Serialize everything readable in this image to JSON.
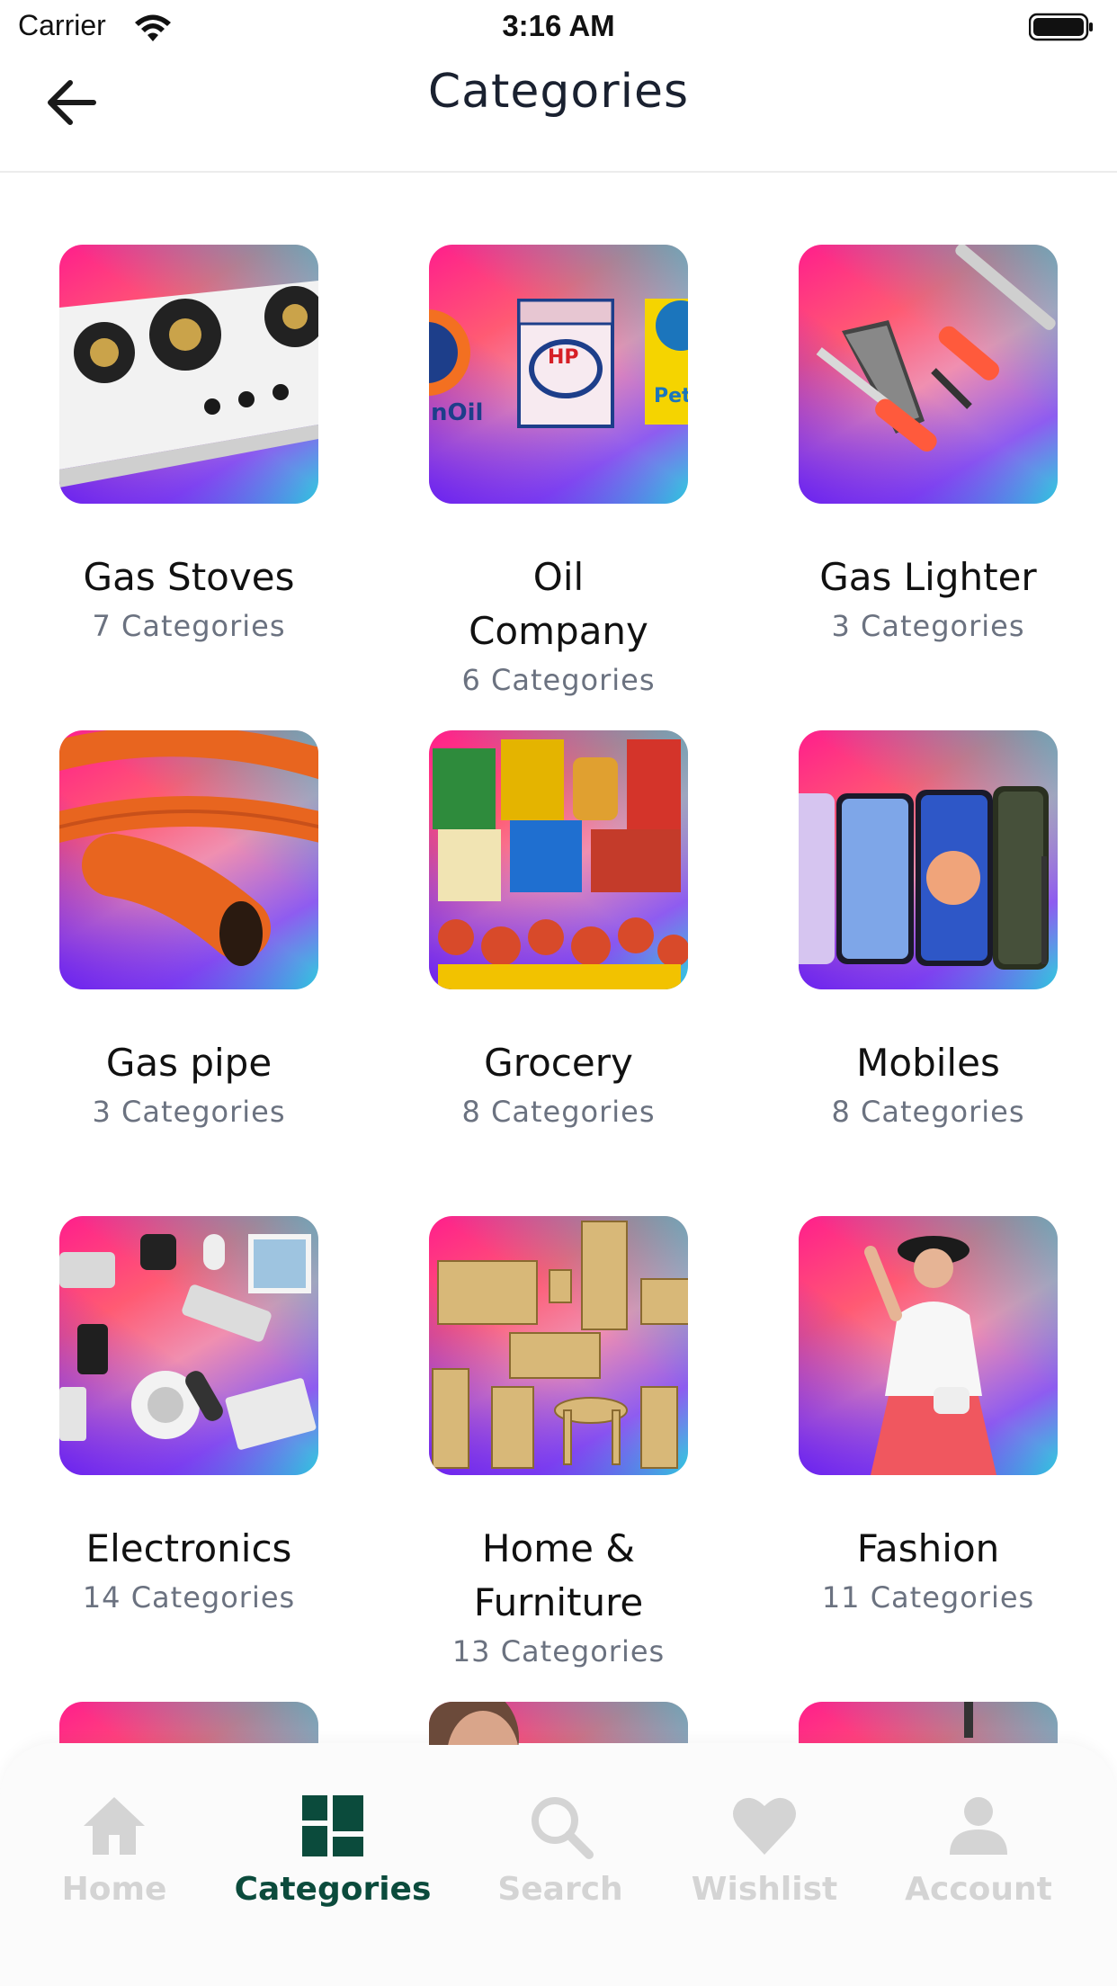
{
  "status_bar": {
    "carrier": "Carrier",
    "time": "3:16 AM"
  },
  "header": {
    "title": "Categories"
  },
  "categories": [
    {
      "name": "Gas Stoves",
      "count": "7 Categories",
      "image": "gas-stove"
    },
    {
      "name": "Oil Company",
      "count": "6 Categories",
      "image": "oil-company"
    },
    {
      "name": "Gas Lighter",
      "count": "3 Categories",
      "image": "gas-lighter"
    },
    {
      "name": "Gas pipe",
      "count": "3 Categories",
      "image": "gas-pipe"
    },
    {
      "name": "Grocery",
      "count": "8 Categories",
      "image": "grocery"
    },
    {
      "name": "Mobiles",
      "count": "8 Categories",
      "image": "mobiles"
    },
    {
      "name": "Electronics",
      "count": "14 Categories",
      "image": "electronics"
    },
    {
      "name": "Home & Furniture",
      "count": "13 Categories",
      "image": "furniture"
    },
    {
      "name": "Fashion",
      "count": "11 Categories",
      "image": "fashion"
    }
  ],
  "bottom_nav": {
    "active_color": "#0b4b3c",
    "inactive_color": "#d4d4d4",
    "items": [
      {
        "label": "Home",
        "icon": "home-icon"
      },
      {
        "label": "Categories",
        "icon": "grid-icon",
        "active": true
      },
      {
        "label": "Search",
        "icon": "search-icon"
      },
      {
        "label": "Wishlist",
        "icon": "heart-icon"
      },
      {
        "label": "Account",
        "icon": "user-icon"
      }
    ]
  }
}
